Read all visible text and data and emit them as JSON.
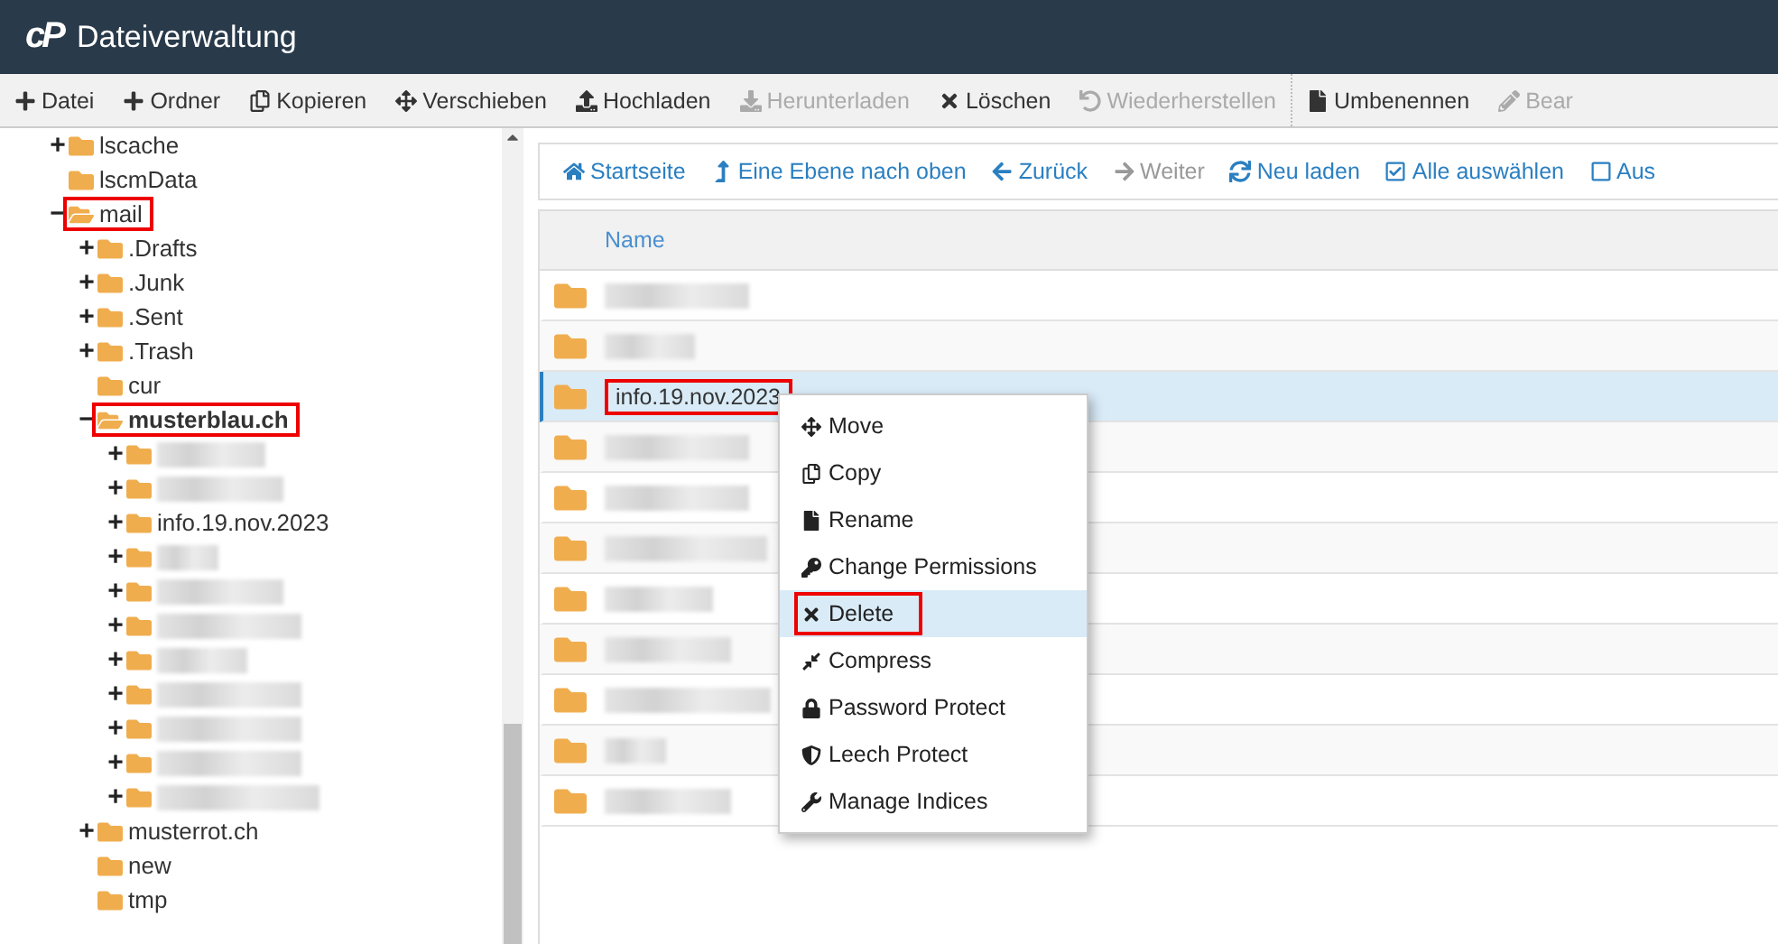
{
  "header": {
    "logo": "cP",
    "title": "Dateiverwaltung"
  },
  "toolbar": [
    {
      "label": "Datei",
      "disabled": false,
      "separator_before": false
    },
    {
      "label": "Ordner",
      "disabled": false,
      "separator_before": false
    },
    {
      "label": "Kopieren",
      "disabled": false,
      "separator_before": false
    },
    {
      "label": "Verschieben",
      "disabled": false,
      "separator_before": false
    },
    {
      "label": "Hochladen",
      "disabled": false,
      "separator_before": false
    },
    {
      "label": "Herunterladen",
      "disabled": true,
      "separator_before": false
    },
    {
      "label": "Löschen",
      "disabled": false,
      "separator_before": false
    },
    {
      "label": "Wiederherstellen",
      "disabled": true,
      "separator_before": false
    },
    {
      "label": "Umbenennen",
      "disabled": false,
      "separator_before": true
    },
    {
      "label": "Bear",
      "disabled": true,
      "separator_before": false
    }
  ],
  "tree": [
    {
      "label": "lscache",
      "expander": "+",
      "open": false,
      "highlighted": false,
      "bold": false
    },
    {
      "label": "lscmData",
      "open": false,
      "highlighted": false,
      "bold": false
    },
    {
      "label": "mail",
      "expander": "−",
      "open": true,
      "highlighted": true,
      "bold": false,
      "children": [
        {
          "label": ".Drafts",
          "expander": "+",
          "open": false,
          "highlighted": false,
          "bold": false
        },
        {
          "label": ".Junk",
          "expander": "+",
          "open": false,
          "highlighted": false,
          "bold": false
        },
        {
          "label": ".Sent",
          "expander": "+",
          "open": false,
          "highlighted": false,
          "bold": false
        },
        {
          "label": ".Trash",
          "expander": "+",
          "open": false,
          "highlighted": false,
          "bold": false
        },
        {
          "label": "cur",
          "open": false,
          "highlighted": false,
          "bold": false
        },
        {
          "label": "musterblau.ch",
          "expander": "−",
          "open": true,
          "highlighted": true,
          "bold": true,
          "children": [
            {
              "redacted": true,
              "expander": "+",
              "open": false,
              "highlighted": false,
              "bold": false
            },
            {
              "redacted": true,
              "expander": "+",
              "open": false,
              "highlighted": false,
              "bold": false
            },
            {
              "label": "info.19.nov.2023",
              "redacted": false,
              "expander": "+",
              "open": false,
              "highlighted": false,
              "bold": false
            },
            {
              "redacted": true,
              "expander": "+",
              "open": false,
              "highlighted": false,
              "bold": false
            },
            {
              "redacted": true,
              "expander": "+",
              "open": false,
              "highlighted": false,
              "bold": false
            },
            {
              "redacted": true,
              "expander": "+",
              "open": false,
              "highlighted": false,
              "bold": false
            },
            {
              "redacted": true,
              "expander": "+",
              "open": false,
              "highlighted": false,
              "bold": false
            },
            {
              "redacted": true,
              "expander": "+",
              "open": false,
              "highlighted": false,
              "bold": false
            },
            {
              "redacted": true,
              "expander": "+",
              "open": false,
              "highlighted": false,
              "bold": false
            },
            {
              "redacted": true,
              "expander": "+",
              "open": false,
              "highlighted": false,
              "bold": false
            },
            {
              "redacted": true,
              "expander": "+",
              "open": false,
              "highlighted": false,
              "bold": false
            }
          ]
        },
        {
          "label": "musterrot.ch",
          "expander": "+",
          "open": false,
          "highlighted": false,
          "bold": false
        },
        {
          "label": "new",
          "open": false,
          "highlighted": false,
          "bold": false
        },
        {
          "label": "tmp",
          "open": false,
          "highlighted": false,
          "bold": false
        }
      ]
    }
  ],
  "nav": [
    {
      "label": "Startseite",
      "disabled": false
    },
    {
      "label": "Eine Ebene nach oben",
      "disabled": false
    },
    {
      "label": "Zurück",
      "disabled": false
    },
    {
      "label": "Weiter",
      "disabled": true
    },
    {
      "label": "Neu laden",
      "disabled": false
    },
    {
      "label": "Alle auswählen",
      "disabled": false
    },
    {
      "label": "Aus",
      "disabled": false
    }
  ],
  "table": {
    "columns": [
      "Name"
    ],
    "rows": [
      {
        "redacted": true,
        "selected": false
      },
      {
        "redacted": true,
        "selected": false
      },
      {
        "name": "info.19.nov.2023",
        "redacted": false,
        "selected": true,
        "highlighted": true
      },
      {
        "redacted": true,
        "selected": false
      },
      {
        "redacted": true,
        "selected": false
      },
      {
        "redacted": true,
        "selected": false
      },
      {
        "redacted": true,
        "selected": false
      },
      {
        "redacted": true,
        "selected": false
      },
      {
        "redacted": true,
        "selected": false
      },
      {
        "redacted": true,
        "selected": false
      },
      {
        "redacted": true,
        "selected": false
      }
    ]
  },
  "context_menu": [
    {
      "label": "Move",
      "hovered": false,
      "highlighted": false
    },
    {
      "label": "Copy",
      "hovered": false,
      "highlighted": false
    },
    {
      "label": "Rename",
      "hovered": false,
      "highlighted": false
    },
    {
      "label": "Change Permissions",
      "hovered": false,
      "highlighted": false
    },
    {
      "label": "Delete",
      "hovered": true,
      "highlighted": true
    },
    {
      "label": "Compress",
      "hovered": false,
      "highlighted": false
    },
    {
      "label": "Password Protect",
      "hovered": false,
      "highlighted": false
    },
    {
      "label": "Leech Protect",
      "hovered": false,
      "highlighted": false
    },
    {
      "label": "Manage Indices",
      "hovered": false,
      "highlighted": false
    }
  ]
}
